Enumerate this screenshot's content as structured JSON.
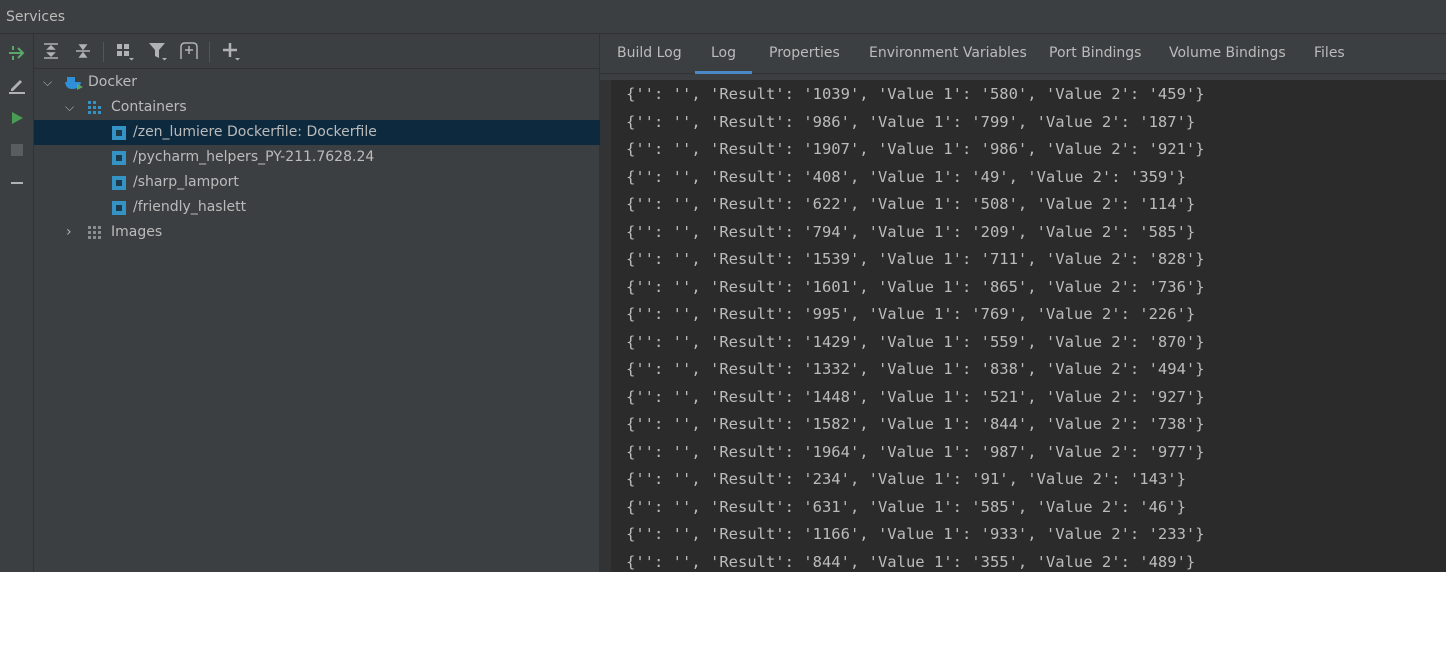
{
  "window": {
    "title": "Services"
  },
  "tree": {
    "root": "Docker",
    "containers_label": "Containers",
    "containers": [
      "/zen_lumiere Dockerfile: Dockerfile",
      "/pycharm_helpers_PY-211.7628.24",
      "/sharp_lamport",
      "/friendly_haslett"
    ],
    "images_label": "Images"
  },
  "tabs": [
    "Build Log",
    "Log",
    "Properties",
    "Environment Variables",
    "Port Bindings",
    "Volume Bindings",
    "Files"
  ],
  "active_tab": "Log",
  "log": [
    "{'': '', 'Result': '1039', 'Value 1': '580', 'Value 2': '459'}",
    "{'': '', 'Result': '986', 'Value 1': '799', 'Value 2': '187'}",
    "{'': '', 'Result': '1907', 'Value 1': '986', 'Value 2': '921'}",
    "{'': '', 'Result': '408', 'Value 1': '49', 'Value 2': '359'}",
    "{'': '', 'Result': '622', 'Value 1': '508', 'Value 2': '114'}",
    "{'': '', 'Result': '794', 'Value 1': '209', 'Value 2': '585'}",
    "{'': '', 'Result': '1539', 'Value 1': '711', 'Value 2': '828'}",
    "{'': '', 'Result': '1601', 'Value 1': '865', 'Value 2': '736'}",
    "{'': '', 'Result': '995', 'Value 1': '769', 'Value 2': '226'}",
    "{'': '', 'Result': '1429', 'Value 1': '559', 'Value 2': '870'}",
    "{'': '', 'Result': '1332', 'Value 1': '838', 'Value 2': '494'}",
    "{'': '', 'Result': '1448', 'Value 1': '521', 'Value 2': '927'}",
    "{'': '', 'Result': '1582', 'Value 1': '844', 'Value 2': '738'}",
    "{'': '', 'Result': '1964', 'Value 1': '987', 'Value 2': '977'}",
    "{'': '', 'Result': '234', 'Value 1': '91', 'Value 2': '143'}",
    "{'': '', 'Result': '631', 'Value 1': '585', 'Value 2': '46'}",
    "{'': '', 'Result': '1166', 'Value 1': '933', 'Value 2': '233'}",
    "{'': '', 'Result': '844', 'Value 1': '355', 'Value 2': '489'}"
  ]
}
